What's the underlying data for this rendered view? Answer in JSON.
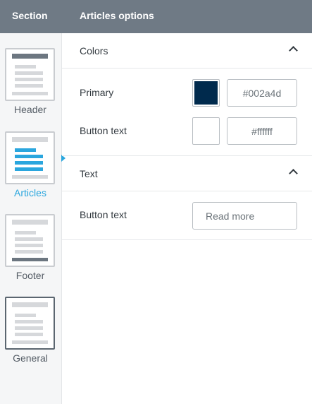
{
  "header": {
    "section_title": "Section",
    "options_title": "Articles options"
  },
  "sidebar": {
    "items": [
      {
        "label": "Header",
        "active": false
      },
      {
        "label": "Articles",
        "active": true
      },
      {
        "label": "Footer",
        "active": false
      },
      {
        "label": "General",
        "active": false
      }
    ]
  },
  "colors": {
    "title": "Colors",
    "primary": {
      "label": "Primary",
      "value": "#002a4d",
      "swatch": "#002a4d"
    },
    "button_text": {
      "label": "Button text",
      "value": "#ffffff",
      "swatch": "#ffffff"
    }
  },
  "text": {
    "title": "Text",
    "button_text": {
      "label": "Button text",
      "value": "Read more"
    }
  },
  "theme": {
    "accent": "#2aa6de",
    "topbar": "#6f7a85"
  }
}
